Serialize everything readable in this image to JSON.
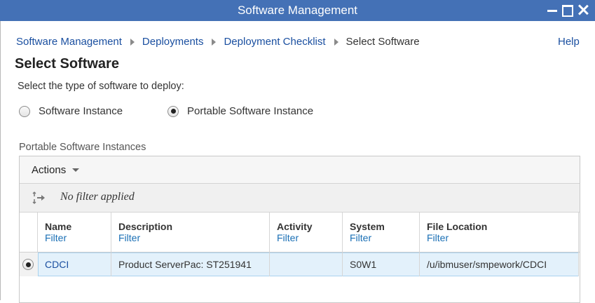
{
  "window": {
    "title": "Software Management"
  },
  "breadcrumb": {
    "items": [
      "Software Management",
      "Deployments",
      "Deployment Checklist"
    ],
    "current": "Select Software"
  },
  "help_label": "Help",
  "page_title": "Select Software",
  "prompt": "Select the type of software to deploy:",
  "software_type": {
    "options": [
      "Software Instance",
      "Portable Software Instance"
    ],
    "selected": "Portable Software Instance"
  },
  "table": {
    "section_label": "Portable Software Instances",
    "actions_label": "Actions",
    "filter_status": "No filter applied",
    "filter_link": "Filter",
    "columns": [
      "Name",
      "Description",
      "Activity",
      "System",
      "File Location"
    ],
    "rows": [
      {
        "name": "CDCI",
        "description": "Product ServerPac: ST251941",
        "activity": "",
        "system": "S0W1",
        "file_location": "/u/ibmuser/smpework/CDCI",
        "selected": true
      }
    ]
  },
  "colors": {
    "title_bar": "#4471b6",
    "link": "#1a4fa0",
    "selected_row": "#e3f1fb"
  }
}
